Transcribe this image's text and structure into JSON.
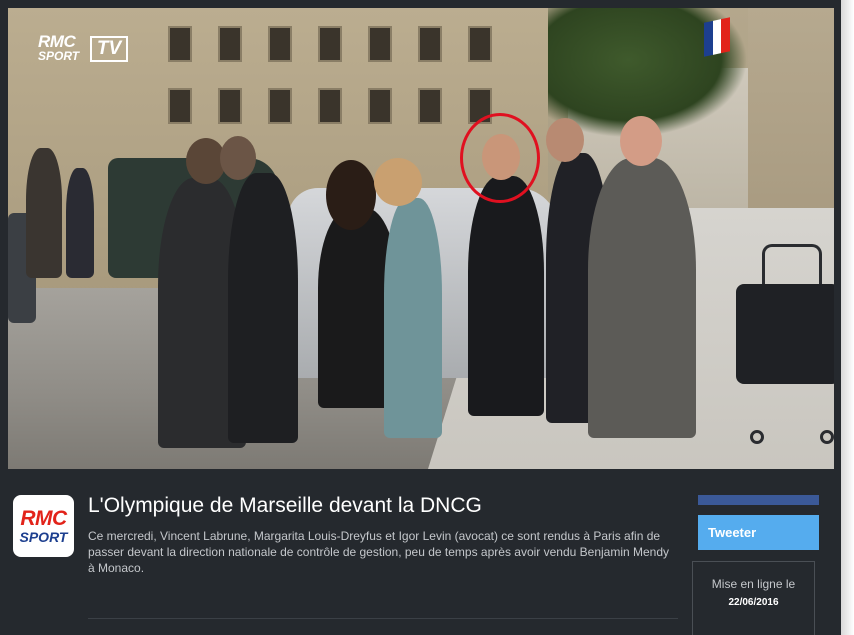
{
  "video": {
    "channel_logo": {
      "line1": "RMC",
      "line2": "SPORT",
      "badge": "TV"
    },
    "highlight_color": "#e01020",
    "flag_colors": [
      "#1d3f8f",
      "#ffffff",
      "#e2231a"
    ]
  },
  "article": {
    "source_logo": {
      "line1": "RMC",
      "line2": "SPORT",
      "colors": [
        "#e2231a",
        "#1d3f8f"
      ]
    },
    "title": "L'Olympique de Marseille devant la DNCG",
    "description": "Ce mercredi, Vincent Labrune, Margarita Louis-Dreyfus et Igor Levin (avocat) ce sont rendus à Paris afin de passer devant la direction nationale de contrôle de gestion, peu de temps après avoir vendu Benjamin Mendy à Monaco."
  },
  "share": {
    "facebook_color": "#3b5998",
    "tweet_label": "Tweeter",
    "tweet_color": "#55acee"
  },
  "publication": {
    "label": "Mise en ligne le",
    "date": "22/06/2016"
  }
}
